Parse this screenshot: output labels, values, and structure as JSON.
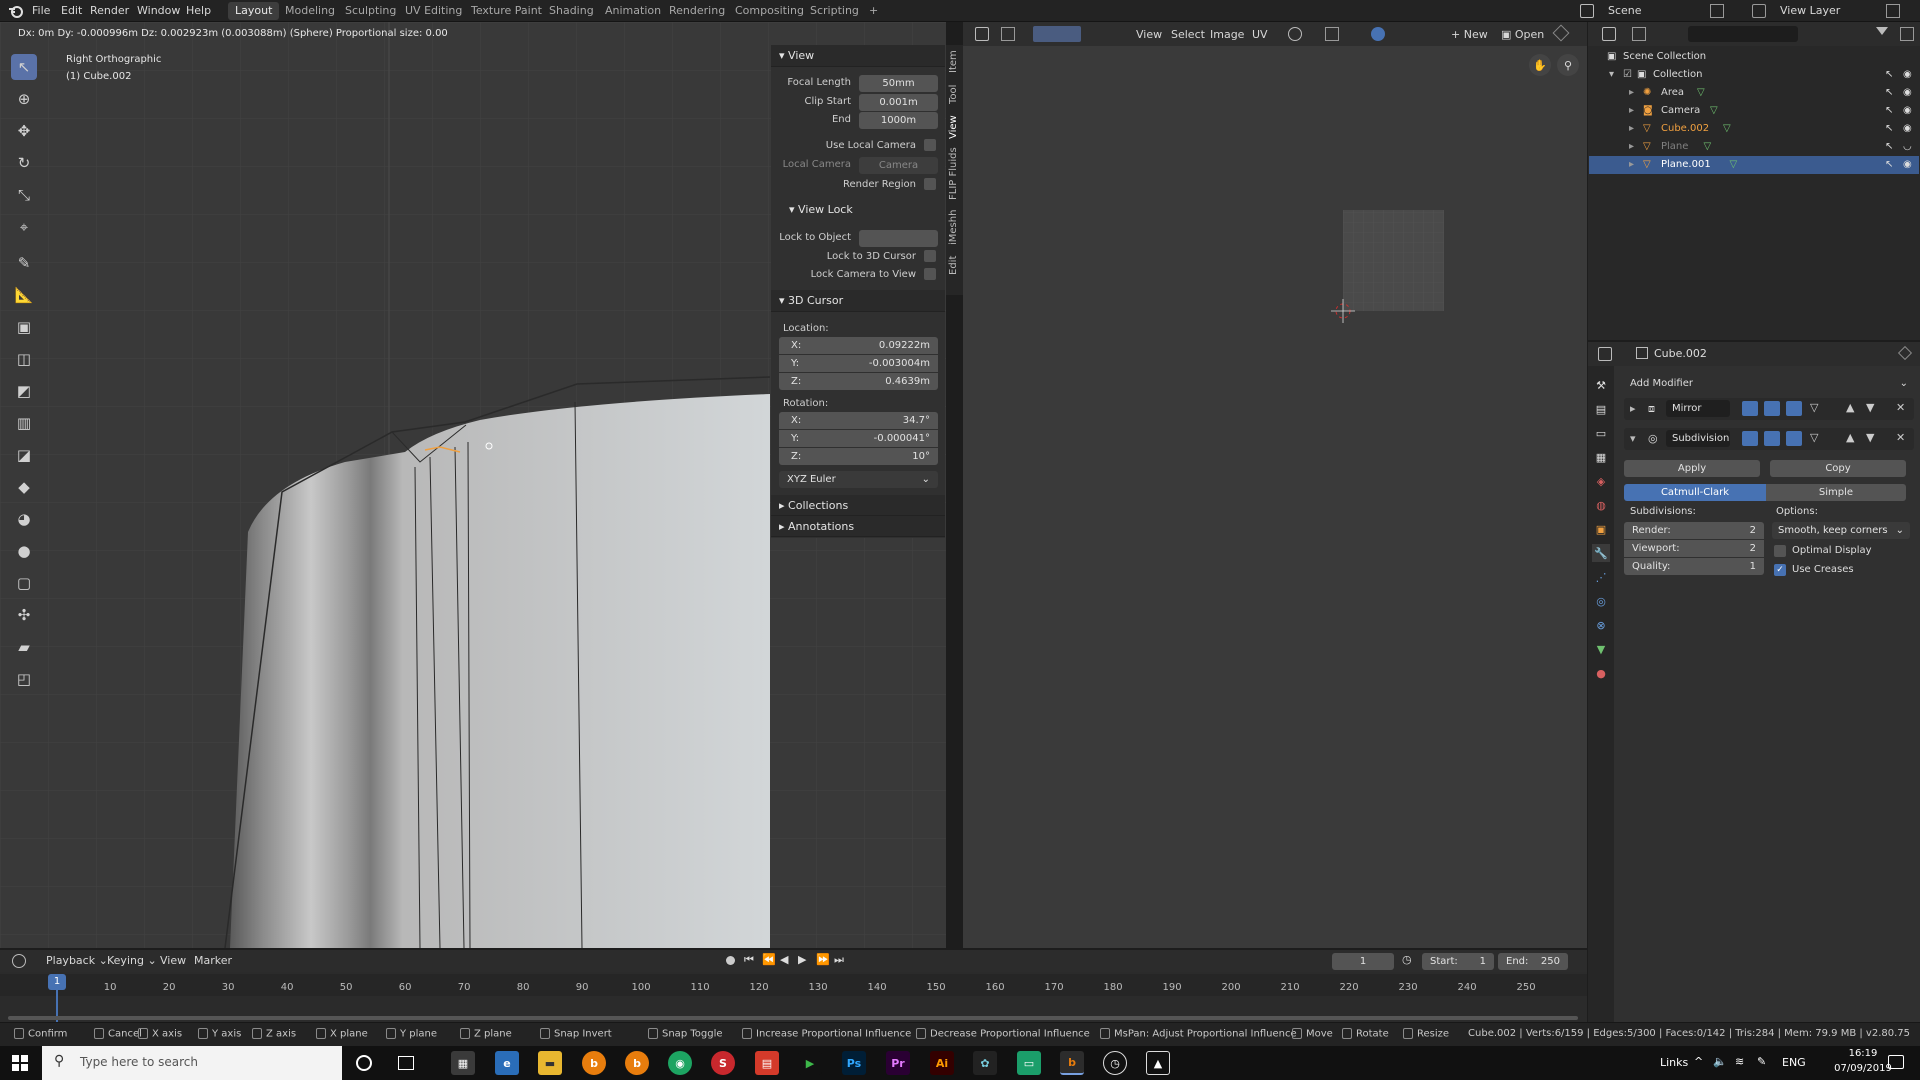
{
  "menus": [
    "File",
    "Edit",
    "Render",
    "Window",
    "Help"
  ],
  "workspaces": [
    "Layout",
    "Modeling",
    "Sculpting",
    "UV Editing",
    "Texture Paint",
    "Shading",
    "Animation",
    "Rendering",
    "Compositing",
    "Scripting"
  ],
  "add_workspace": "+",
  "scene": {
    "icon": "scene-icon",
    "label": "Scene"
  },
  "view_layer": {
    "label": "View Layer"
  },
  "viewport": {
    "header_text": "Dx: 0m   Dy: -0.000996m   Dz: 0.002923m (0.003088m) (Sphere)   Proportional size: 0.00",
    "view_name": "Right Orthographic",
    "object_name": "(1) Cube.002"
  },
  "npanel": {
    "view_title": "View",
    "focal_length_label": "Focal Length",
    "focal_length": "50mm",
    "clip_start_label": "Clip Start",
    "clip_start": "0.001m",
    "end_label": "End",
    "end": "1000m",
    "use_local_camera": "Use Local Camera",
    "local_camera_label": "Local Camera",
    "local_camera_value": "Camera",
    "render_region": "Render Region",
    "view_lock_title": "View Lock",
    "lock_to_object": "Lock to Object",
    "lock_to_3d_cursor": "Lock to 3D Cursor",
    "lock_camera_to_view": "Lock Camera to View",
    "cursor_title": "3D Cursor",
    "location_label": "Location:",
    "loc_x": "0.09222m",
    "loc_y": "-0.003004m",
    "loc_z": "0.4639m",
    "rotation_label": "Rotation:",
    "rot_x": "34.7°",
    "rot_y": "-0.000041°",
    "rot_z": "10°",
    "axis_x": "X:",
    "axis_y": "Y:",
    "axis_z": "Z:",
    "rotation_mode": "XYZ Euler",
    "collections": "Collections",
    "annotations": "Annotations",
    "tabs": [
      "Item",
      "Tool",
      "View",
      "FLIP Fluids",
      "iMeshh",
      "Edit"
    ]
  },
  "image_editor": {
    "menus": [
      "View",
      "Select",
      "Image",
      "UV"
    ],
    "new": "New",
    "open": "Open"
  },
  "outliner": {
    "root": "Scene Collection",
    "collection": "Collection",
    "items": [
      {
        "name": "Area",
        "icon": "light-icon",
        "color": "#d8d8d8"
      },
      {
        "name": "Camera",
        "icon": "camera-icon",
        "color": "#d8d8d8"
      },
      {
        "name": "Cube.002",
        "icon": "mesh-icon",
        "color": "#f0a040"
      },
      {
        "name": "Plane",
        "icon": "mesh-icon",
        "color": "#808080"
      },
      {
        "name": "Plane.001",
        "icon": "mesh-icon",
        "color": "#ffffff"
      }
    ]
  },
  "properties": {
    "object": "Cube.002",
    "add_modifier": "Add Modifier",
    "mirror": "Mirror",
    "subdivision": "Subdivision",
    "apply": "Apply",
    "copy": "Copy",
    "catmull": "Catmull-Clark",
    "simple": "Simple",
    "subdivisions_label": "Subdivisions:",
    "options_label": "Options:",
    "render_label": "Render:",
    "render_value": "2",
    "viewport_label": "Viewport:",
    "viewport_value": "2",
    "quality_label": "Quality:",
    "quality_value": "1",
    "smooth_option": "Smooth, keep corners",
    "optimal_display": "Optimal Display",
    "use_creases": "Use Creases"
  },
  "timeline": {
    "menus": [
      "Playback",
      "Keying",
      "View",
      "Marker"
    ],
    "current_frame": "1",
    "start_label": "Start:",
    "start": "1",
    "end_label": "End:",
    "end": "250",
    "ticks": [
      "1",
      "10",
      "20",
      "30",
      "40",
      "50",
      "60",
      "70",
      "80",
      "90",
      "100",
      "110",
      "120",
      "130",
      "140",
      "150",
      "160",
      "170",
      "180",
      "190",
      "200",
      "210",
      "220",
      "230",
      "240",
      "250"
    ]
  },
  "statusbar": {
    "items": [
      "Confirm",
      "Cancel",
      "X axis",
      "Y axis",
      "Z axis",
      "X plane",
      "Y plane",
      "Z plane",
      "Snap Invert",
      "Snap Toggle",
      "Increase Proportional Influence",
      "Decrease Proportional Influence",
      "MsPan: Adjust Proportional Influence",
      "Move",
      "Rotate",
      "Resize"
    ],
    "stats": "Cube.002 | Verts:6/159 | Edges:5/300 | Faces:0/142 | Tris:284 | Mem: 79.9 MB | v2.80.75"
  },
  "taskbar": {
    "search_placeholder": "Type here to search",
    "links": "Links",
    "lang": "ENG",
    "time": "16:19",
    "date": "07/09/2019"
  },
  "colors": {
    "accent": "#4772b3",
    "active_tool": "#5a72a8",
    "selected_row": "#3b5b8f",
    "orange": "#f0a040"
  }
}
